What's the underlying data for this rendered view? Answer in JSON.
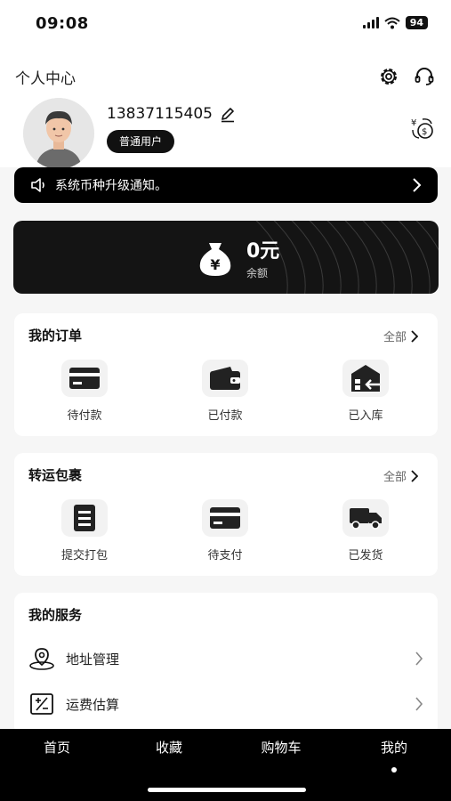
{
  "status_bar": {
    "time": "09:08",
    "battery": "94"
  },
  "header": {
    "title": "个人中心",
    "phone": "13837115405",
    "user_level": "普通用户"
  },
  "notice": {
    "text": "系统币种升级通知。"
  },
  "balance": {
    "amount": "0元",
    "label": "余额",
    "icon_symbol": "¥"
  },
  "orders": {
    "title": "我的订单",
    "all_label": "全部",
    "items": [
      {
        "label": "待付款",
        "icon": "card-icon"
      },
      {
        "label": "已付款",
        "icon": "wallet-icon"
      },
      {
        "label": "已入库",
        "icon": "warehouse-icon"
      }
    ]
  },
  "transit": {
    "title": "转运包裹",
    "all_label": "全部",
    "items": [
      {
        "label": "提交打包",
        "icon": "document-icon"
      },
      {
        "label": "待支付",
        "icon": "card-icon"
      },
      {
        "label": "已发货",
        "icon": "truck-icon"
      }
    ]
  },
  "services": {
    "title": "我的服务",
    "items": [
      {
        "label": "地址管理",
        "icon": "location-icon"
      },
      {
        "label": "运费估算",
        "icon": "calculator-icon"
      }
    ]
  },
  "tabbar": {
    "items": [
      {
        "label": "首页"
      },
      {
        "label": "收藏"
      },
      {
        "label": "购物车"
      },
      {
        "label": "我的"
      }
    ],
    "active_index": 3
  }
}
